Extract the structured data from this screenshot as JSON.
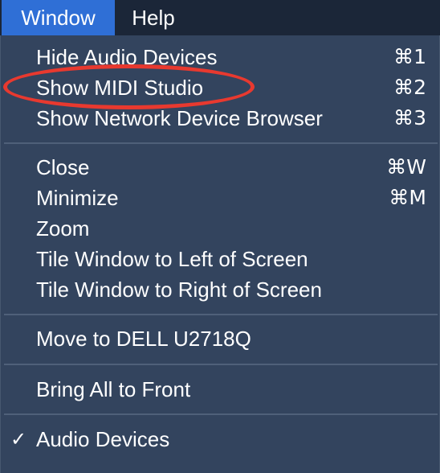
{
  "menubar": {
    "window_label": "Window",
    "help_label": "Help"
  },
  "menu": {
    "groups": [
      [
        {
          "label": "Hide Audio Devices",
          "shortcut": "⌘1"
        },
        {
          "label": "Show MIDI Studio",
          "shortcut": "⌘2"
        },
        {
          "label": "Show Network Device Browser",
          "shortcut": "⌘3"
        }
      ],
      [
        {
          "label": "Close",
          "shortcut": "⌘W"
        },
        {
          "label": "Minimize",
          "shortcut": "⌘M"
        },
        {
          "label": "Zoom",
          "shortcut": ""
        },
        {
          "label": "Tile Window to Left of Screen",
          "shortcut": ""
        },
        {
          "label": "Tile Window to Right of Screen",
          "shortcut": ""
        }
      ],
      [
        {
          "label": "Move to DELL U2718Q",
          "shortcut": ""
        }
      ],
      [
        {
          "label": "Bring All to Front",
          "shortcut": ""
        }
      ],
      [
        {
          "label": "Audio Devices",
          "shortcut": "",
          "checked": true,
          "check_mark": "✓"
        }
      ]
    ]
  },
  "colors": {
    "menubar": "#1b2638",
    "menu_background": "#33445e",
    "selected_menubar_item": "#2f6fd6",
    "annotation_ring": "#e8392f"
  }
}
